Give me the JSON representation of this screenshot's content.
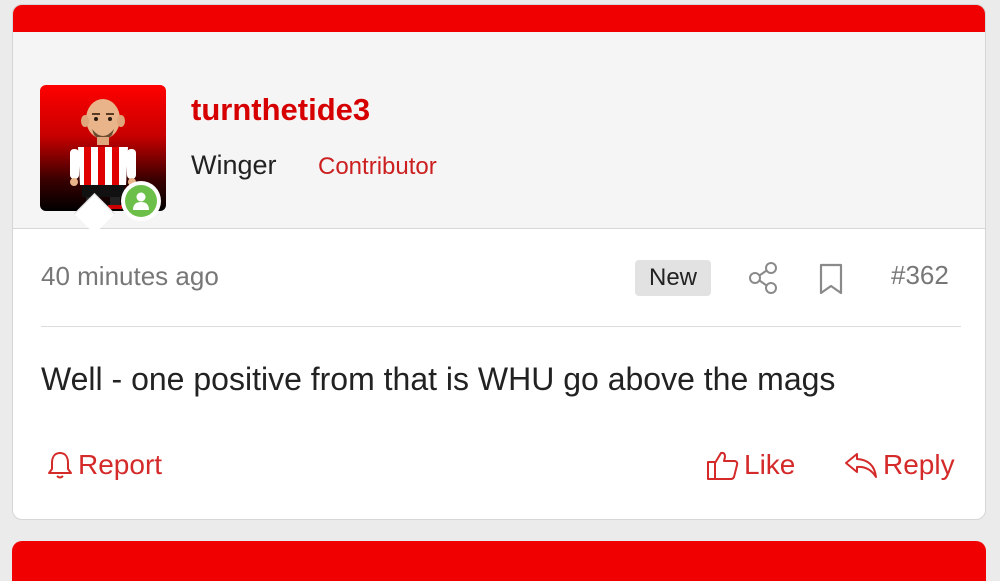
{
  "post": {
    "username": "turnthetide3",
    "user_title": "Winger",
    "user_banner": "Contributor",
    "timestamp": "40 minutes ago",
    "new_badge": "New",
    "post_number": "#362",
    "message": "Well - one positive from that is WHU go above the mags",
    "online": true
  },
  "actions": {
    "report_label": "Report",
    "like_label": "Like",
    "reply_label": "Reply"
  },
  "icons": {
    "avatar": "avatar-image",
    "status": "online-status-icon",
    "share": "share-icon",
    "bookmark": "bookmark-icon",
    "report": "bell-icon",
    "like": "thumbs-up-icon",
    "reply": "reply-arrow-icon"
  },
  "colors": {
    "brand_red": "#f00000",
    "accent_red": "#d60000",
    "online_green": "#6cc04a",
    "muted_text": "#777777"
  }
}
